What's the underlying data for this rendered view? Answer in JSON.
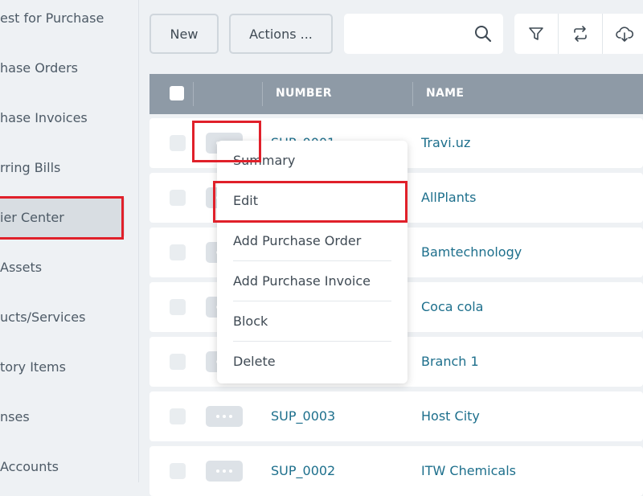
{
  "sidebar": {
    "items": [
      {
        "label": "est for Purchase"
      },
      {
        "label": "hase Orders"
      },
      {
        "label": "hase Invoices"
      },
      {
        "label": "rring Bills"
      },
      {
        "label": "ier Center"
      },
      {
        "label": "Assets"
      },
      {
        "label": "ucts/Services"
      },
      {
        "label": "tory Items"
      },
      {
        "label": "nses"
      },
      {
        "label": "Accounts"
      }
    ]
  },
  "toolbar": {
    "new_label": "New",
    "actions_label": "Actions ...",
    "search_placeholder": "",
    "icons": [
      "search-icon",
      "filter-icon",
      "sync-icon",
      "cloud-download-icon"
    ]
  },
  "table": {
    "columns": [
      "NUMBER",
      "NAME"
    ],
    "rows": [
      {
        "number": "SUP_0001",
        "name": "Travi.uz"
      },
      {
        "number": "",
        "name": "AllPlants"
      },
      {
        "number": "",
        "name": "Bamtechnology"
      },
      {
        "number": "",
        "name": "Coca cola"
      },
      {
        "number": "",
        "name": "Branch 1"
      },
      {
        "number": "SUP_0003",
        "name": "Host City"
      },
      {
        "number": "SUP_0002",
        "name": "ITW Chemicals"
      }
    ]
  },
  "context_menu": {
    "items": [
      {
        "label": "Summary"
      },
      {
        "label": "Edit"
      },
      {
        "label": "Add Purchase Order"
      },
      {
        "label": "Add Purchase Invoice"
      },
      {
        "label": "Block"
      },
      {
        "label": "Delete"
      }
    ]
  },
  "colors": {
    "accent_link": "#1d6f8c",
    "header_bg": "#8e9aa6",
    "highlight": "#e0202a"
  }
}
